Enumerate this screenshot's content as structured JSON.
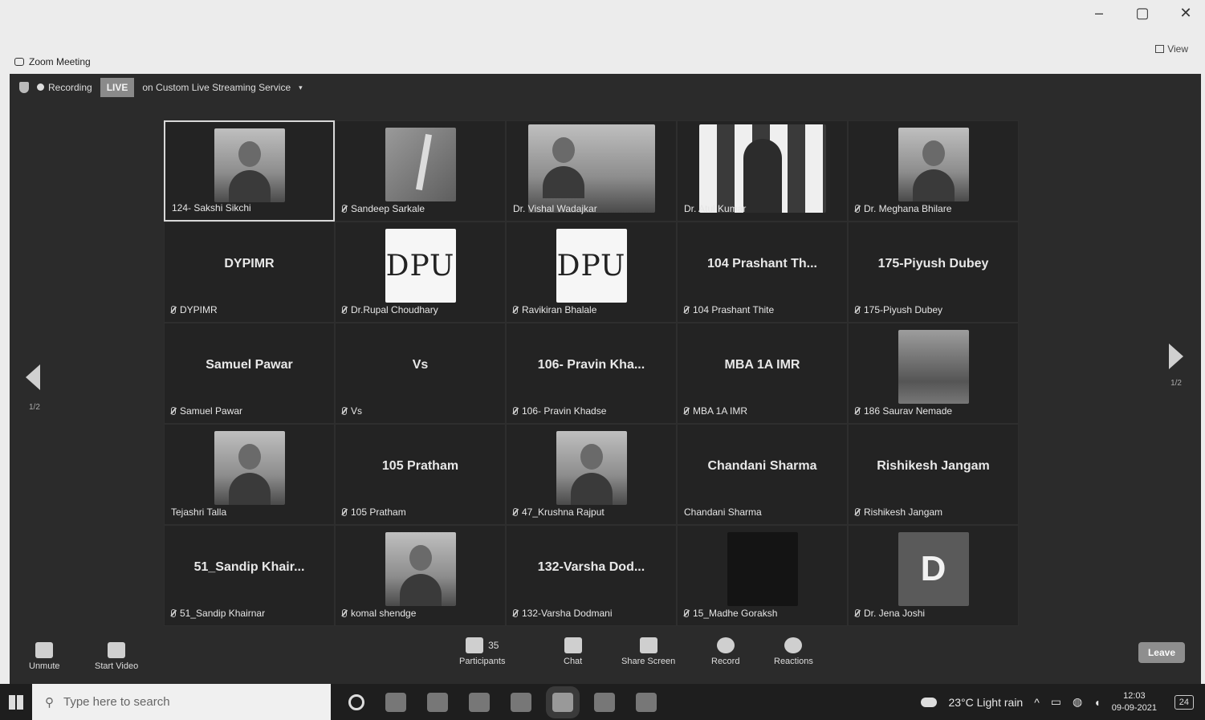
{
  "window": {
    "title": "Zoom Meeting",
    "controls": [
      "–",
      "▢",
      "✕"
    ],
    "view_label": "View"
  },
  "status": {
    "recording": "Recording",
    "live": "LIVE",
    "stream_text": "on Custom Live Streaming Service",
    "stream_caret": "▾"
  },
  "tiles": [
    {
      "kind": "photo",
      "photo": "person",
      "label": "124- Sakshi Sikchi",
      "muted": false,
      "active": true
    },
    {
      "kind": "photo",
      "photo": "pen",
      "label": "Sandeep Sarkale",
      "muted": true
    },
    {
      "kind": "photo",
      "photo": "person-wide",
      "label": "Dr. Vishal Wadajkar",
      "muted": false
    },
    {
      "kind": "photo",
      "photo": "checker",
      "label": "Dr. Atul Kumar",
      "muted": false
    },
    {
      "kind": "photo",
      "photo": "person",
      "label": "Dr. Meghana Bhilare",
      "muted": true
    },
    {
      "kind": "name",
      "big": "DYPIMR",
      "label": "DYPIMR",
      "muted": true
    },
    {
      "kind": "photo",
      "photo": "logo",
      "logo_text": "DPU",
      "label": "Dr.Rupal Choudhary",
      "muted": true
    },
    {
      "kind": "photo",
      "photo": "logo",
      "logo_text": "DPU",
      "label": "Ravikiran Bhalale",
      "muted": true
    },
    {
      "kind": "name",
      "big": "104 Prashant Th...",
      "label": "104 Prashant Thite",
      "muted": true
    },
    {
      "kind": "name",
      "big": "175-Piyush Dubey",
      "label": "175-Piyush Dubey",
      "muted": true
    },
    {
      "kind": "name",
      "big": "Samuel Pawar",
      "label": "Samuel Pawar",
      "muted": true
    },
    {
      "kind": "name",
      "big": "Vs",
      "label": "Vs",
      "muted": true
    },
    {
      "kind": "name",
      "big": "106- Pravin Kha...",
      "label": "106- Pravin Khadse",
      "muted": true
    },
    {
      "kind": "name",
      "big": "MBA 1A IMR",
      "label": "MBA 1A IMR",
      "muted": true
    },
    {
      "kind": "photo",
      "photo": "scene",
      "label": "186 Saurav Nemade",
      "muted": true
    },
    {
      "kind": "photo",
      "photo": "person",
      "label": "Tejashri Talla",
      "muted": false
    },
    {
      "kind": "name",
      "big": "105 Pratham",
      "label": "105 Pratham",
      "muted": true
    },
    {
      "kind": "photo",
      "photo": "person",
      "label": "47_Krushna Rajput",
      "muted": true
    },
    {
      "kind": "name",
      "big": "Chandani Sharma",
      "label": "Chandani Sharma",
      "muted": false
    },
    {
      "kind": "name",
      "big": "Rishikesh Jangam",
      "label": "Rishikesh Jangam",
      "muted": true
    },
    {
      "kind": "name",
      "big": "51_Sandip Khair...",
      "label": "51_Sandip Khairnar",
      "muted": true
    },
    {
      "kind": "photo",
      "photo": "person",
      "label": "komal shendge",
      "muted": true
    },
    {
      "kind": "name",
      "big": "132-Varsha Dod...",
      "label": "132-Varsha Dodmani",
      "muted": true
    },
    {
      "kind": "photo",
      "photo": "dark",
      "label": "15_Madhe Goraksh",
      "muted": true
    },
    {
      "kind": "photo",
      "photo": "letter",
      "letter": "D",
      "label": "Dr. Jena Joshi",
      "muted": true
    }
  ],
  "pagination": {
    "left": "1/2",
    "right": "1/2"
  },
  "toolbar": {
    "unmute": "Unmute",
    "start_video": "Start Video",
    "participants": "Participants",
    "participants_count": "35",
    "chat": "Chat",
    "share_screen": "Share Screen",
    "record": "Record",
    "reactions": "Reactions",
    "leave": "Leave"
  },
  "taskbar": {
    "search_placeholder": "Type here to search",
    "weather": "23°C  Light rain",
    "time": "12:03",
    "date": "09-09-2021",
    "notifications": "24"
  }
}
